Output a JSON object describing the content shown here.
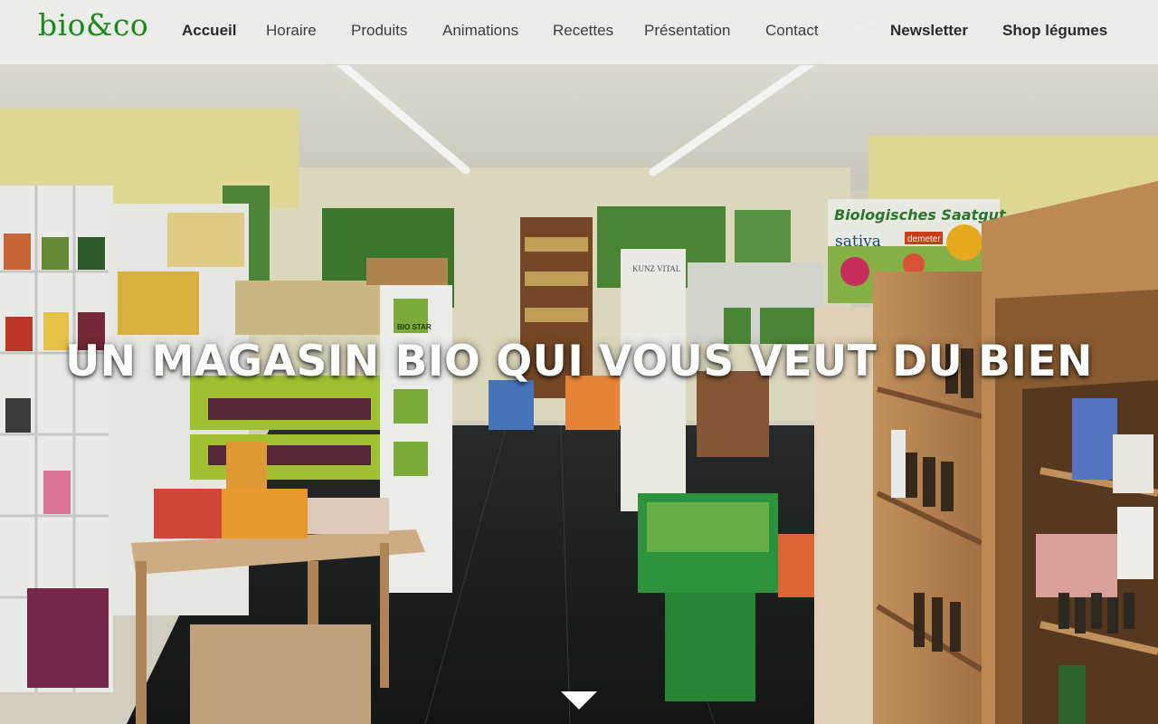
{
  "brand": {
    "logo_text": "bio&co",
    "color": "#178a1c"
  },
  "nav": {
    "items": [
      {
        "label": "Accueil",
        "active": true
      },
      {
        "label": "Horaire"
      },
      {
        "label": "Produits"
      },
      {
        "label": "Animations"
      },
      {
        "label": "Recettes"
      },
      {
        "label": "Présentation"
      },
      {
        "label": "Contact"
      }
    ],
    "right_items": [
      {
        "label": "Newsletter"
      },
      {
        "label": "Shop légumes"
      }
    ]
  },
  "hero": {
    "headline": "UN MAGASIN BIO QUI VOUS VEUT DU BIEN",
    "scroll_icon": "chevron-down-icon",
    "poster": {
      "title": "Biologisches Saatgut",
      "brand": "sativa",
      "sub": "demeter"
    },
    "sign_left": "BIO STAR",
    "sign_center": "KUNZ VITAL"
  }
}
